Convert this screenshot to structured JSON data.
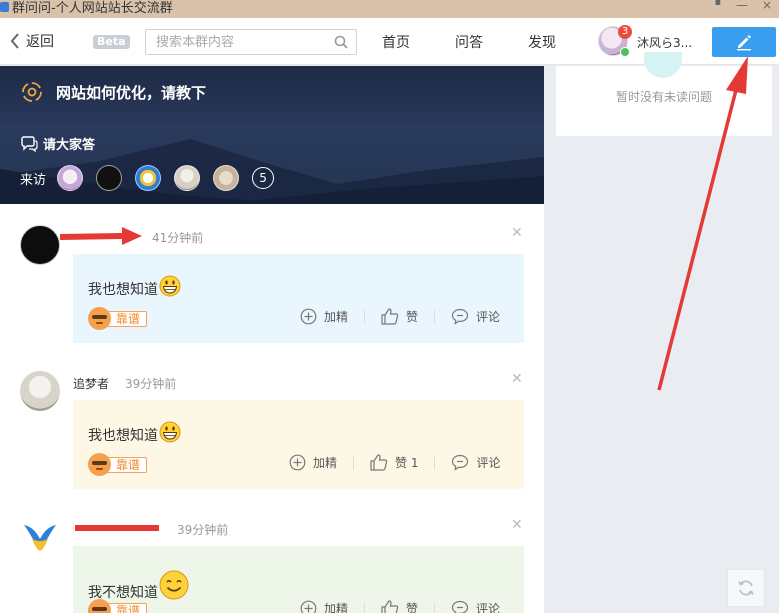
{
  "window": {
    "title": "群问问-个人网站站长交流群"
  },
  "nav": {
    "back": "返回",
    "beta": "Beta",
    "search_placeholder": "搜索本群内容",
    "links": [
      "首页",
      "问答",
      "发现"
    ],
    "user": {
      "name": "沐风ら3...",
      "unread_count": "3"
    }
  },
  "hero": {
    "question": "网站如何优化，请教下",
    "answer_prompt": "请大家答",
    "visitors_label": "来访",
    "visitors_more": "5"
  },
  "answers": [
    {
      "user": "",
      "time": "41分钟前",
      "text": "我也想知道",
      "kaopu": "靠谱",
      "feature": "加精",
      "like": "赞",
      "comment": "评论",
      "bubble_color": "#eaf6fd"
    },
    {
      "user": "追梦者",
      "time": "39分钟前",
      "text": "我也想知道",
      "kaopu": "靠谱",
      "feature": "加精",
      "like": "赞 1",
      "comment": "评论",
      "bubble_color": "#fdf8e6"
    },
    {
      "user": "",
      "time": "39分钟前",
      "text": "我不想知道",
      "kaopu": "靠谱",
      "feature": "加精",
      "like": "赞",
      "comment": "评论",
      "bubble_color": "#eef5e9"
    }
  ],
  "sidebar": {
    "empty_text": "暂时没有未读问题"
  },
  "icons": [
    "back-chevron-icon",
    "search-icon",
    "compose-pencil-icon",
    "target-icon",
    "chat-icon",
    "plus-circle-icon",
    "thumbs-up-icon",
    "comment-icon",
    "refresh-icon",
    "grin-emoji-icon",
    "smile-emoji-icon"
  ],
  "colors": {
    "accent": "#3a9ef0",
    "annotation": "#e53935",
    "kaopu": "#f08a24"
  }
}
